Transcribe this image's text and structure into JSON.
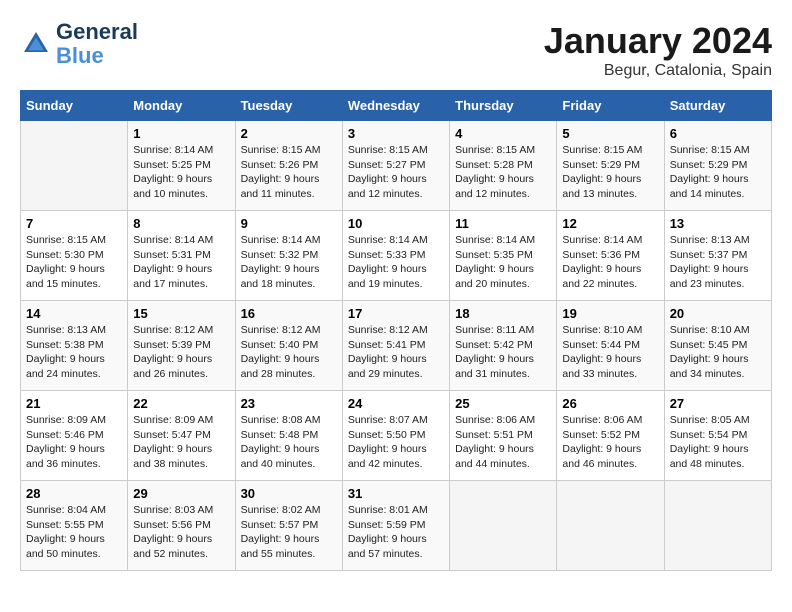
{
  "header": {
    "logo_line1": "General",
    "logo_line2": "Blue",
    "month": "January 2024",
    "location": "Begur, Catalonia, Spain"
  },
  "weekdays": [
    "Sunday",
    "Monday",
    "Tuesday",
    "Wednesday",
    "Thursday",
    "Friday",
    "Saturday"
  ],
  "weeks": [
    [
      {
        "day": "",
        "info": ""
      },
      {
        "day": "1",
        "info": "Sunrise: 8:14 AM\nSunset: 5:25 PM\nDaylight: 9 hours\nand 10 minutes."
      },
      {
        "day": "2",
        "info": "Sunrise: 8:15 AM\nSunset: 5:26 PM\nDaylight: 9 hours\nand 11 minutes."
      },
      {
        "day": "3",
        "info": "Sunrise: 8:15 AM\nSunset: 5:27 PM\nDaylight: 9 hours\nand 12 minutes."
      },
      {
        "day": "4",
        "info": "Sunrise: 8:15 AM\nSunset: 5:28 PM\nDaylight: 9 hours\nand 12 minutes."
      },
      {
        "day": "5",
        "info": "Sunrise: 8:15 AM\nSunset: 5:29 PM\nDaylight: 9 hours\nand 13 minutes."
      },
      {
        "day": "6",
        "info": "Sunrise: 8:15 AM\nSunset: 5:29 PM\nDaylight: 9 hours\nand 14 minutes."
      }
    ],
    [
      {
        "day": "7",
        "info": "Sunrise: 8:15 AM\nSunset: 5:30 PM\nDaylight: 9 hours\nand 15 minutes."
      },
      {
        "day": "8",
        "info": "Sunrise: 8:14 AM\nSunset: 5:31 PM\nDaylight: 9 hours\nand 17 minutes."
      },
      {
        "day": "9",
        "info": "Sunrise: 8:14 AM\nSunset: 5:32 PM\nDaylight: 9 hours\nand 18 minutes."
      },
      {
        "day": "10",
        "info": "Sunrise: 8:14 AM\nSunset: 5:33 PM\nDaylight: 9 hours\nand 19 minutes."
      },
      {
        "day": "11",
        "info": "Sunrise: 8:14 AM\nSunset: 5:35 PM\nDaylight: 9 hours\nand 20 minutes."
      },
      {
        "day": "12",
        "info": "Sunrise: 8:14 AM\nSunset: 5:36 PM\nDaylight: 9 hours\nand 22 minutes."
      },
      {
        "day": "13",
        "info": "Sunrise: 8:13 AM\nSunset: 5:37 PM\nDaylight: 9 hours\nand 23 minutes."
      }
    ],
    [
      {
        "day": "14",
        "info": "Sunrise: 8:13 AM\nSunset: 5:38 PM\nDaylight: 9 hours\nand 24 minutes."
      },
      {
        "day": "15",
        "info": "Sunrise: 8:12 AM\nSunset: 5:39 PM\nDaylight: 9 hours\nand 26 minutes."
      },
      {
        "day": "16",
        "info": "Sunrise: 8:12 AM\nSunset: 5:40 PM\nDaylight: 9 hours\nand 28 minutes."
      },
      {
        "day": "17",
        "info": "Sunrise: 8:12 AM\nSunset: 5:41 PM\nDaylight: 9 hours\nand 29 minutes."
      },
      {
        "day": "18",
        "info": "Sunrise: 8:11 AM\nSunset: 5:42 PM\nDaylight: 9 hours\nand 31 minutes."
      },
      {
        "day": "19",
        "info": "Sunrise: 8:10 AM\nSunset: 5:44 PM\nDaylight: 9 hours\nand 33 minutes."
      },
      {
        "day": "20",
        "info": "Sunrise: 8:10 AM\nSunset: 5:45 PM\nDaylight: 9 hours\nand 34 minutes."
      }
    ],
    [
      {
        "day": "21",
        "info": "Sunrise: 8:09 AM\nSunset: 5:46 PM\nDaylight: 9 hours\nand 36 minutes."
      },
      {
        "day": "22",
        "info": "Sunrise: 8:09 AM\nSunset: 5:47 PM\nDaylight: 9 hours\nand 38 minutes."
      },
      {
        "day": "23",
        "info": "Sunrise: 8:08 AM\nSunset: 5:48 PM\nDaylight: 9 hours\nand 40 minutes."
      },
      {
        "day": "24",
        "info": "Sunrise: 8:07 AM\nSunset: 5:50 PM\nDaylight: 9 hours\nand 42 minutes."
      },
      {
        "day": "25",
        "info": "Sunrise: 8:06 AM\nSunset: 5:51 PM\nDaylight: 9 hours\nand 44 minutes."
      },
      {
        "day": "26",
        "info": "Sunrise: 8:06 AM\nSunset: 5:52 PM\nDaylight: 9 hours\nand 46 minutes."
      },
      {
        "day": "27",
        "info": "Sunrise: 8:05 AM\nSunset: 5:54 PM\nDaylight: 9 hours\nand 48 minutes."
      }
    ],
    [
      {
        "day": "28",
        "info": "Sunrise: 8:04 AM\nSunset: 5:55 PM\nDaylight: 9 hours\nand 50 minutes."
      },
      {
        "day": "29",
        "info": "Sunrise: 8:03 AM\nSunset: 5:56 PM\nDaylight: 9 hours\nand 52 minutes."
      },
      {
        "day": "30",
        "info": "Sunrise: 8:02 AM\nSunset: 5:57 PM\nDaylight: 9 hours\nand 55 minutes."
      },
      {
        "day": "31",
        "info": "Sunrise: 8:01 AM\nSunset: 5:59 PM\nDaylight: 9 hours\nand 57 minutes."
      },
      {
        "day": "",
        "info": ""
      },
      {
        "day": "",
        "info": ""
      },
      {
        "day": "",
        "info": ""
      }
    ]
  ]
}
